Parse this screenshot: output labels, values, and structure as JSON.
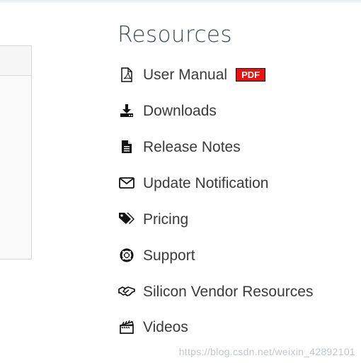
{
  "resources": {
    "title": "Resources",
    "items": [
      {
        "label": "User Manual",
        "icon": "pdf-file-icon",
        "badge": "PDF"
      },
      {
        "label": "Downloads",
        "icon": "download-icon"
      },
      {
        "label": "Release Notes",
        "icon": "document-icon"
      },
      {
        "label": "Update Notification",
        "icon": "envelope-icon"
      },
      {
        "label": "Pricing",
        "icon": "tags-icon"
      },
      {
        "label": "Support",
        "icon": "life-ring-icon"
      },
      {
        "label": "Silicon Vendor Resources",
        "icon": "handshake-icon"
      },
      {
        "label": "Videos",
        "icon": "clapperboard-icon"
      }
    ]
  },
  "watermark": "https://blog.csdn.net/weixin_42892101",
  "colors": {
    "text": "#3a3a3a",
    "title": "#3f4a52",
    "pdf_badge": "#ea1111",
    "panel_border": "#d6d6d6"
  }
}
